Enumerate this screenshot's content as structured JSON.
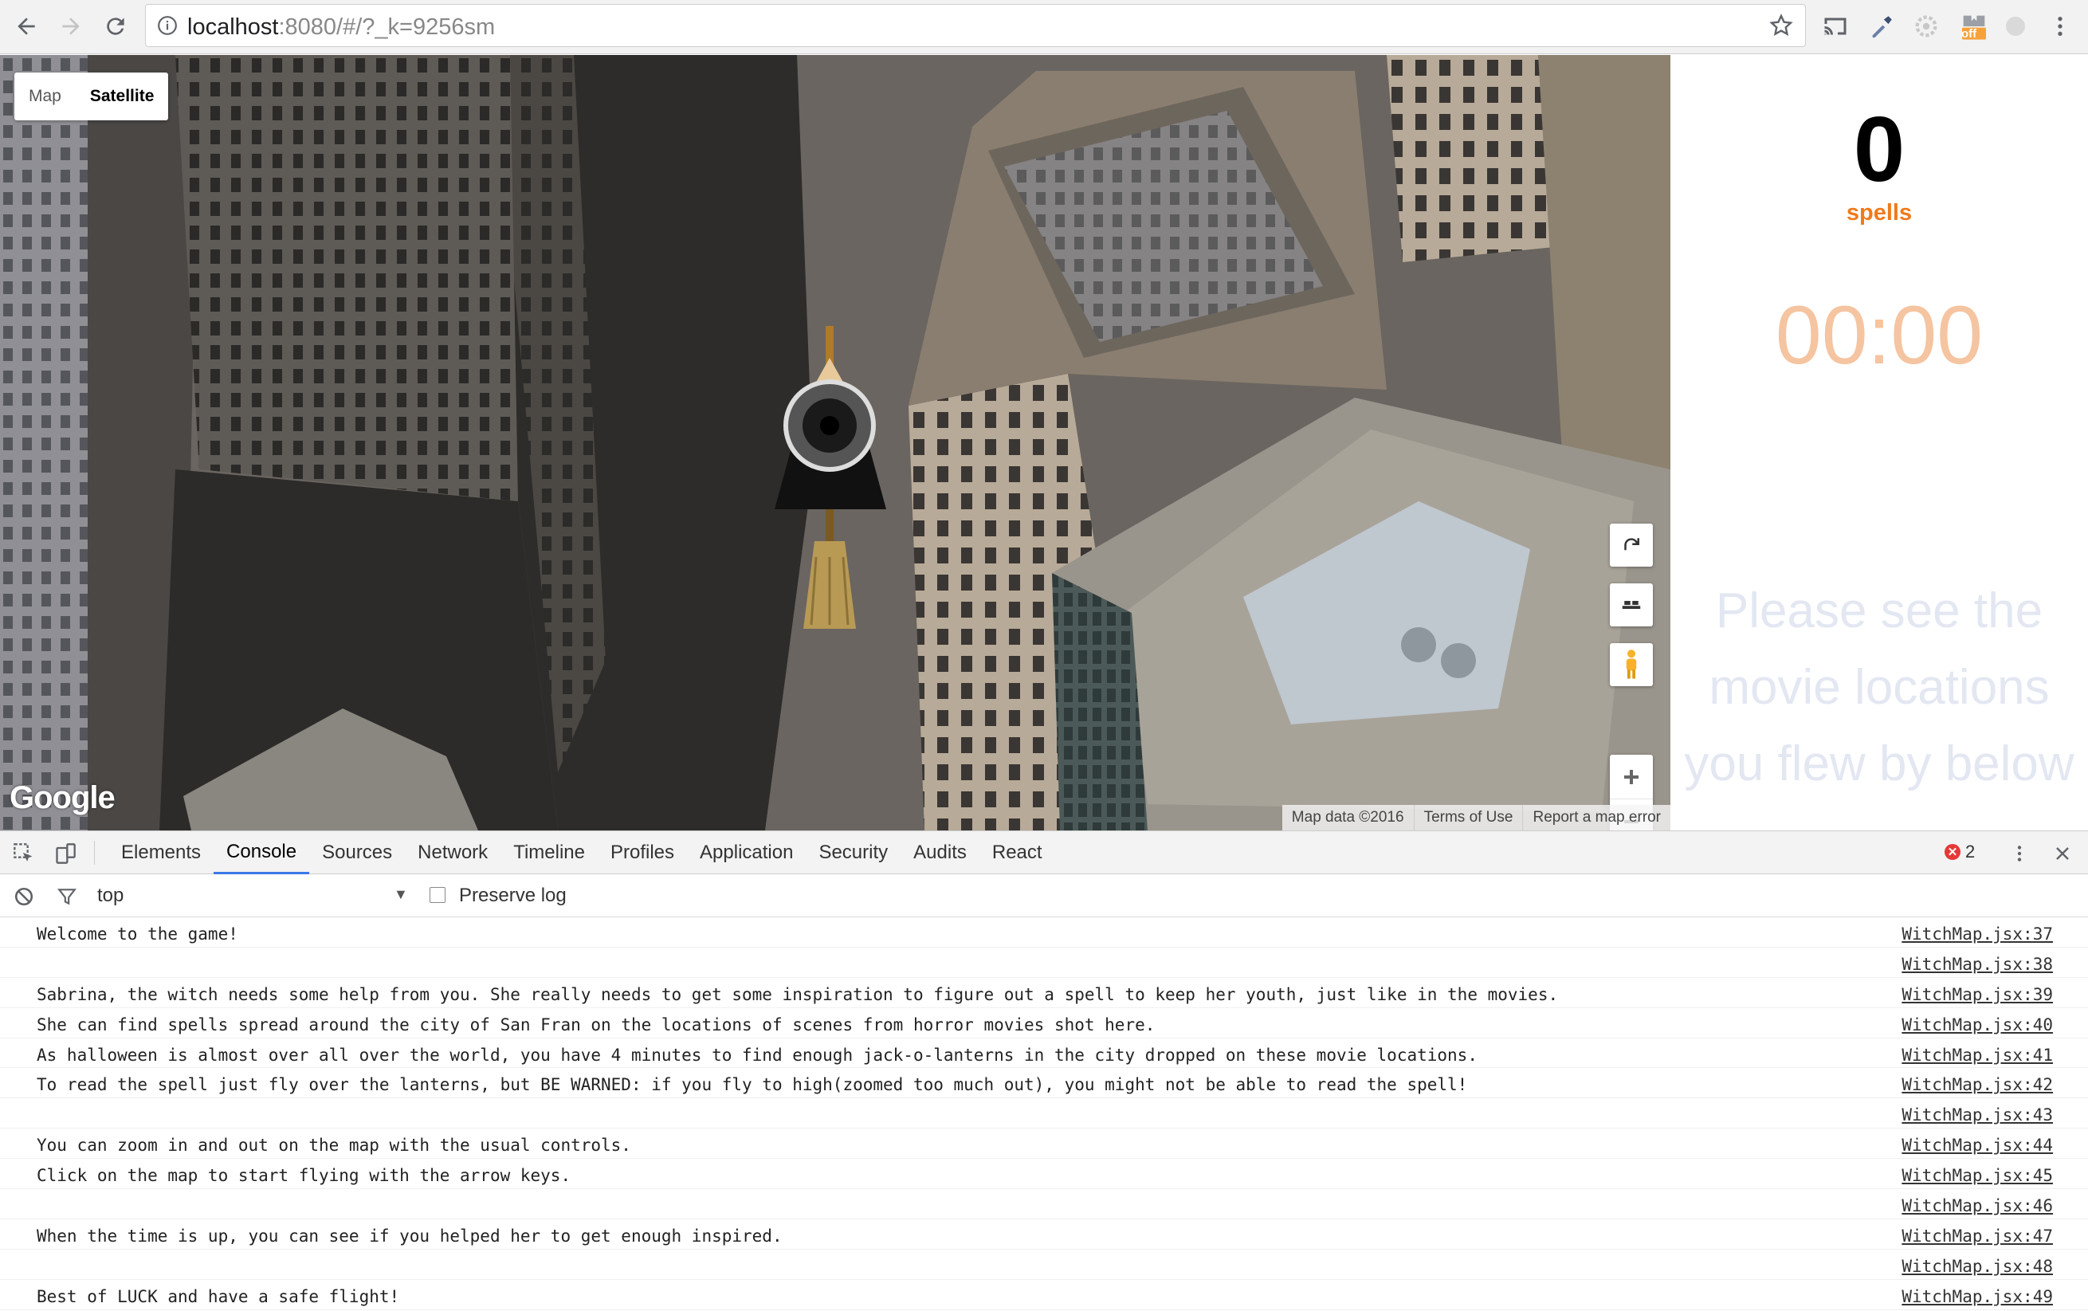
{
  "browser": {
    "url_host": "localhost",
    "url_rest": ":8080/#/?_k=9256sm",
    "extensions": [
      "cast-icon",
      "eyedropper-icon",
      "settings-extension-icon",
      "off-extension-icon",
      "half-moon-extension-icon"
    ],
    "off_badge": "off"
  },
  "map": {
    "type_options": [
      "Map",
      "Satellite"
    ],
    "selected_type": "Satellite",
    "logo": "Google",
    "attribution": {
      "map_data": "Map data ©2016",
      "terms": "Terms of Use",
      "report": "Report a map error"
    }
  },
  "side": {
    "spells_count": "0",
    "spells_label": "spells",
    "timer": "00:00",
    "notice": "Please see the movie locations you flew by below",
    "colors": {
      "spells_label": "#f07a1a",
      "timer": "#f5c4a0",
      "notice": "#e3e7f2"
    }
  },
  "devtools": {
    "tabs": [
      "Elements",
      "Console",
      "Sources",
      "Network",
      "Timeline",
      "Profiles",
      "Application",
      "Security",
      "Audits",
      "React"
    ],
    "active_tab": "Console",
    "error_count": "2",
    "context": "top",
    "preserve_log_label": "Preserve log",
    "logs": [
      {
        "msg": "Welcome to the game!",
        "src": "WitchMap.jsx:37"
      },
      {
        "msg": "",
        "src": "WitchMap.jsx:38"
      },
      {
        "msg": "Sabrina, the witch needs some help from you. She really needs to get some inspiration to figure out a spell to keep her youth, just like in the movies.",
        "src": "WitchMap.jsx:39"
      },
      {
        "msg": "She can find spells spread around the city of San Fran on the locations of scenes from horror movies shot here.",
        "src": "WitchMap.jsx:40"
      },
      {
        "msg": "As halloween is almost over all over the world, you have 4 minutes to find enough jack-o-lanterns in the city dropped on these movie locations.",
        "src": "WitchMap.jsx:41"
      },
      {
        "msg": "To read the spell just fly over the lanterns, but BE WARNED: if you fly to high(zoomed too much out), you might not be able to read the spell!",
        "src": "WitchMap.jsx:42"
      },
      {
        "msg": "",
        "src": "WitchMap.jsx:43"
      },
      {
        "msg": "You can zoom in and out on the map with the usual controls.",
        "src": "WitchMap.jsx:44"
      },
      {
        "msg": "Click on the map to start flying with the arrow keys.",
        "src": "WitchMap.jsx:45"
      },
      {
        "msg": "",
        "src": "WitchMap.jsx:46"
      },
      {
        "msg": "When the time is up, you can see if you helped her to get enough inspired.",
        "src": "WitchMap.jsx:47"
      },
      {
        "msg": "",
        "src": "WitchMap.jsx:48"
      },
      {
        "msg": "Best of LUCK and have a safe flight!",
        "src": "WitchMap.jsx:49"
      }
    ]
  }
}
